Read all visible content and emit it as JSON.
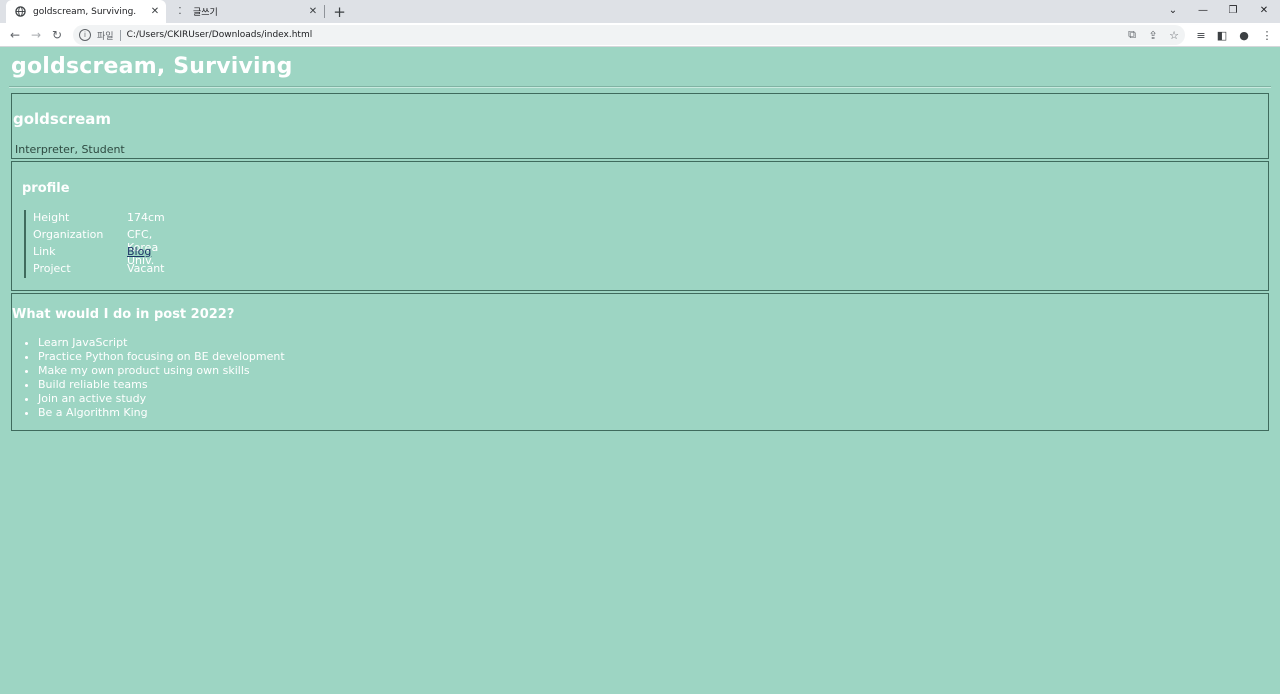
{
  "browser": {
    "tabs": [
      {
        "title": "goldscream, Surviving.",
        "active": true,
        "icon": "globe-icon"
      },
      {
        "title": "글쓰기",
        "active": false,
        "icon": "editor-icon"
      }
    ],
    "address": {
      "scheme_label": "파일",
      "url": "C:/Users/CKIRUser/Downloads/index.html"
    }
  },
  "page": {
    "title": "goldscream, Surviving",
    "header": {
      "name": "goldscream",
      "roles": "Interpreter, Student"
    },
    "profile": {
      "title": "profile",
      "rows": [
        {
          "key": "Height",
          "value": "174cm"
        },
        {
          "key": "Organization",
          "value": "CFC, Korea Univ."
        },
        {
          "key": "Link",
          "value": "Blog"
        },
        {
          "key": "Project",
          "value": "Vacant"
        }
      ]
    },
    "plans": {
      "title": "What would I do in post 2022?",
      "items": [
        "Learn JavaScript",
        "Practice Python focusing on BE development",
        "Make my own product using own skills",
        "Build reliable teams",
        "Join an active study",
        "Be a Algorithm King"
      ]
    }
  },
  "colors": {
    "background": "#9dd5c3",
    "border": "#3f6b5d",
    "link": "#1c3566"
  }
}
